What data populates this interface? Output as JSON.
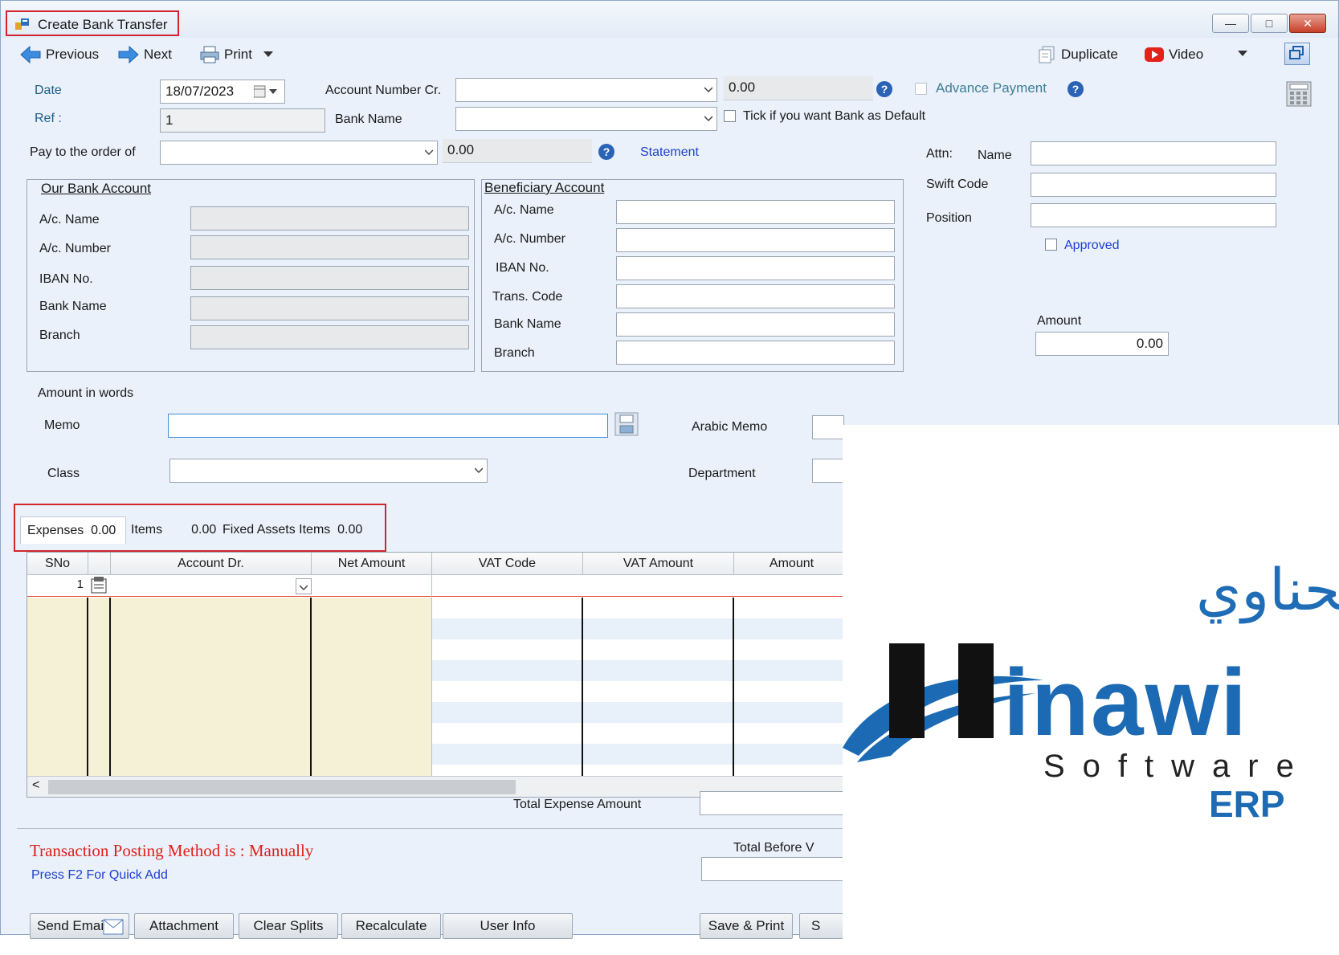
{
  "window": {
    "title": "Create Bank Transfer"
  },
  "toolbar": {
    "previous": "Previous",
    "next": "Next",
    "print": "Print",
    "duplicate": "Duplicate",
    "video": "Video"
  },
  "header": {
    "date_label": "Date",
    "date_value": "18/07/2023",
    "ref_label": "Ref :",
    "ref_value": "1",
    "account_cr_label": "Account Number Cr.",
    "account_cr_value": "",
    "account_cr_balance": "0.00",
    "bank_name_label": "Bank Name",
    "bank_name_value": "",
    "advance_payment_label": "Advance Payment",
    "default_bank_label": "Tick if you want Bank as Default",
    "pay_to_label": "Pay to the order of",
    "pay_to_value": "",
    "pay_to_balance": "0.00",
    "statement_link": "Statement"
  },
  "attn": {
    "attn_label": "Attn:",
    "name_label": "Name",
    "swift_label": "Swift Code",
    "position_label": "Position",
    "approved_label": "Approved",
    "amount_label": "Amount",
    "amount_value": "0.00"
  },
  "our_bank": {
    "title": "Our Bank Account",
    "fields": [
      "A/c. Name",
      "A/c. Number",
      "IBAN No.",
      "Bank Name",
      "Branch"
    ]
  },
  "beneficiary": {
    "title": "Beneficiary Account",
    "fields": [
      "A/c. Name",
      "A/c. Number",
      "IBAN No.",
      "Trans. Code",
      "Bank Name",
      "Branch"
    ]
  },
  "memo": {
    "amount_words_label": "Amount in words",
    "memo_label": "Memo",
    "arabic_memo_label": "Arabic Memo",
    "class_label": "Class",
    "department_label": "Department"
  },
  "tabs": [
    {
      "label": "Expenses",
      "value": "0.00"
    },
    {
      "label": "Items",
      "value": "0.00"
    },
    {
      "label": "Fixed Assets Items",
      "value": "0.00"
    }
  ],
  "grid": {
    "columns": [
      "SNo",
      "",
      "Account Dr.",
      "Net Amount",
      "VAT Code",
      "VAT Amount",
      "Amount"
    ],
    "rows": [
      {
        "sno": "1"
      }
    ]
  },
  "footer": {
    "total_expense_label": "Total Expense Amount",
    "total_before_label": "Total Before V",
    "posting_method": "Transaction Posting Method is : Manually",
    "quick_add": "Press F2 For Quick Add",
    "buttons": [
      "Send Email",
      "Attachment",
      "Clear Splits",
      "Recalculate",
      "User Info",
      "Save & Print",
      "S"
    ]
  },
  "logo": {
    "arabic": "برنامج الحناوي",
    "word": "inawi",
    "software": "Software",
    "erp": "ERP"
  },
  "colors": {
    "accent": "#2a62b6",
    "warning_red": "#e0201a",
    "link_blue": "#1f3fd0",
    "logo_blue": "#1b6ab3"
  }
}
